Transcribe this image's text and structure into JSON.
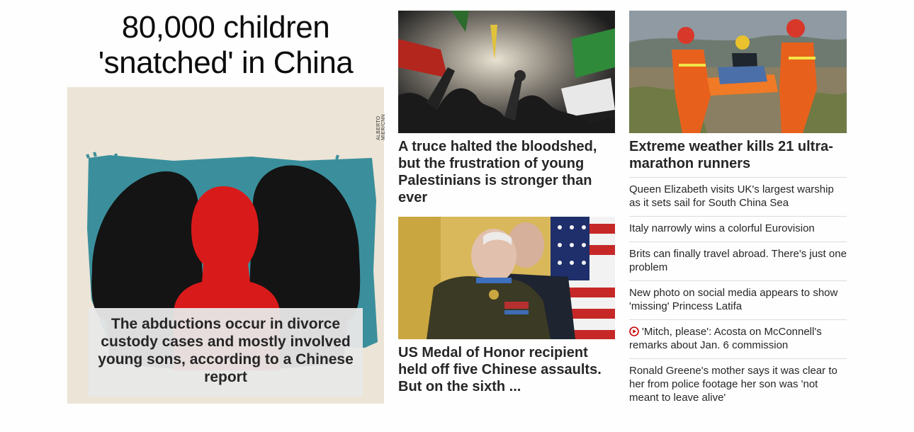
{
  "lead": {
    "title_line1": "80,000 children",
    "title_line2": "'snatched' in China",
    "image_credit": "ALBERTO MIER/CNN",
    "caption": "The abductions occur in divorce custody cases and mostly involved young sons, according to a Chinese report"
  },
  "middle": {
    "story1": {
      "headline": "A truce halted the bloodshed, but the frustration of young Palestinians is stronger than ever"
    },
    "story2": {
      "headline": "US Medal of Honor recipient held off five Chinese assaults. But on the sixth ..."
    }
  },
  "right": {
    "headline": "Extreme weather kills 21 ultra-marathon runners",
    "links": [
      {
        "text": "Queen Elizabeth visits UK's largest warship as it sets sail for South China Sea"
      },
      {
        "text": "Italy narrowly wins a colorful Eurovision"
      },
      {
        "text": "Brits can finally travel abroad. There's just one problem"
      },
      {
        "text": "New photo on social media appears to show 'missing' Princess Latifa"
      },
      {
        "text": "'Mitch, please': Acosta on McConnell's remarks about Jan. 6 commission",
        "icon": "video-play-icon"
      },
      {
        "text": "Ronald Greene's mother says it was clear to her from police footage her son was 'not meant to leave alive'"
      }
    ]
  },
  "colors": {
    "link_red": "#cc0000",
    "teal": "#3b8f9c",
    "red_silhouette": "#d91a1a"
  }
}
